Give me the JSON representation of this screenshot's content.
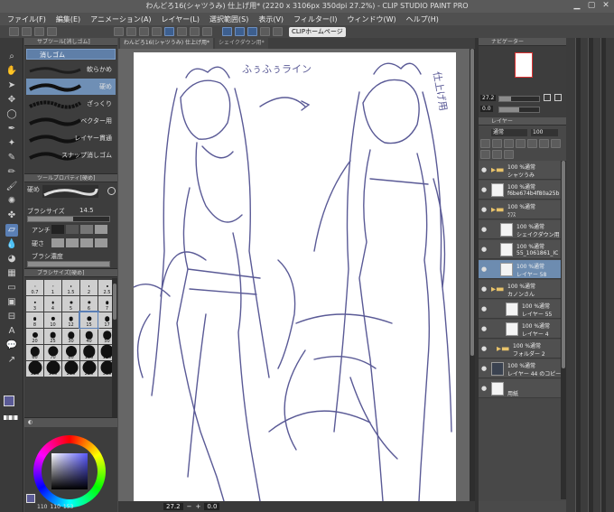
{
  "title": "わんどろ16(シャツうみ) 仕上げ用* (2220 x 3106px 350dpi 27.2%) - CLIP STUDIO PAINT PRO",
  "menu": [
    "ファイル(F)",
    "編集(E)",
    "アニメーション(A)",
    "レイヤー(L)",
    "選択範囲(S)",
    "表示(V)",
    "フィルター(I)",
    "ウィンドウ(W)",
    "ヘルプ(H)"
  ],
  "command_bar": {
    "clip_button": "CLIPホームページ"
  },
  "subtool": {
    "header": "サブツール[消しゴム]",
    "group_tab": "消しゴム",
    "brushes": [
      "軟らかめ",
      "硬め",
      "ざっくり",
      "ベクター用",
      "レイヤー貫通",
      "スナップ消しゴム"
    ]
  },
  "tool_property": {
    "header": "ツールプロパティ[硬め]",
    "tool_name": "硬め",
    "brush_size_label": "ブラシサイズ",
    "brush_size_value": "14.5",
    "antialias_label": "アンチ",
    "hardness_label": "硬さ",
    "density_label": "ブラシ濃度"
  },
  "brush_size_panel": {
    "header": "ブラシサイズ[硬め]",
    "sizes": [
      "0.7",
      "1",
      "1.5",
      "2",
      "2.5",
      "3",
      "4",
      "5",
      "6",
      "7",
      "8",
      "10",
      "12",
      "15",
      "17",
      "20",
      "25",
      "30",
      "40",
      "50",
      "60",
      "70",
      "80",
      "100",
      "120",
      "150",
      "170",
      "200",
      "250",
      "300"
    ],
    "selected": "15"
  },
  "color": {
    "main": "#5a5a96",
    "values": [
      "110",
      "110",
      "153"
    ]
  },
  "canvas": {
    "tabs": [
      "わんどろ16(シャツうみ) 仕上げ用*",
      "シェイクダウン用*"
    ],
    "sketch_note_left": "ふぅふぅライン",
    "sketch_note_right": "仕上げ用",
    "zoom": "27.2",
    "rotation": "0.0"
  },
  "navigator": {
    "header": "ナビゲーター",
    "zoom": "27.2",
    "rotation": "0.0"
  },
  "layers": {
    "header": "レイヤー",
    "blend_mode": "通常",
    "opacity": "100",
    "items": [
      {
        "mode": "100 %通常",
        "name": "シャツうみ",
        "type": "folder"
      },
      {
        "mode": "100 %通常",
        "name": "f6be674b4f80a25b",
        "type": "image"
      },
      {
        "mode": "100 %通常",
        "name": "ﾗﾌｽ",
        "type": "folder"
      },
      {
        "mode": "100 %通常",
        "name": "シェイクダウン用",
        "type": "layer"
      },
      {
        "mode": "100 %通常",
        "name": "55_1061861_IC",
        "type": "layer"
      },
      {
        "mode": "100 %通常",
        "name": "レイヤー 58",
        "type": "layer",
        "selected": true
      },
      {
        "mode": "100 %通常",
        "name": "カノンさん",
        "type": "folder"
      },
      {
        "mode": "100 %通常",
        "name": "レイヤー 55",
        "type": "layer"
      },
      {
        "mode": "100 %通常",
        "name": "レイヤー 4",
        "type": "layer"
      },
      {
        "mode": "100 %通常",
        "name": "フォルダー 2",
        "type": "folder"
      },
      {
        "mode": "100 %通常",
        "name": "レイヤー 44 のコピー",
        "type": "dark"
      },
      {
        "mode": "",
        "name": "用紙",
        "type": "paper"
      }
    ]
  }
}
